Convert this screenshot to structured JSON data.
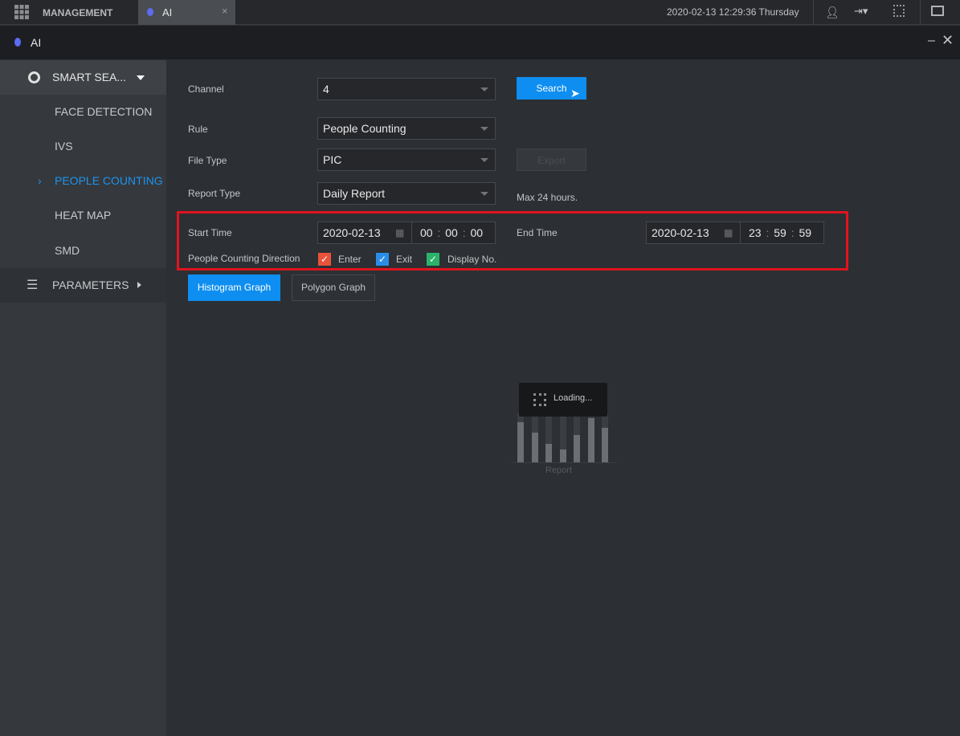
{
  "topbar": {
    "management_label": "MANAGEMENT",
    "tab_label": "AI",
    "datetime": "2020-02-13 12:29:36 Thursday"
  },
  "window": {
    "title": "AI"
  },
  "sidebar": {
    "smart_search": "SMART SEA...",
    "items": [
      {
        "label": "FACE DETECTION"
      },
      {
        "label": "IVS"
      },
      {
        "label": "PEOPLE COUNTING",
        "active": true
      },
      {
        "label": "HEAT MAP"
      },
      {
        "label": "SMD"
      }
    ],
    "parameters": "PARAMETERS"
  },
  "form": {
    "channel_label": "Channel",
    "channel_value": "4",
    "search_label": "Search",
    "rule_label": "Rule",
    "rule_value": "People Counting",
    "file_type_label": "File Type",
    "file_type_value": "PIC",
    "export_label": "Export",
    "report_type_label": "Report Type",
    "report_type_value": "Daily Report",
    "max_hint": "Max 24 hours.",
    "start_time_label": "Start Time",
    "start_date": "2020-02-13",
    "start_h": "00",
    "start_m": "00",
    "start_s": "00",
    "end_time_label": "End Time",
    "end_date": "2020-02-13",
    "end_h": "23",
    "end_m": "59",
    "end_s": "59",
    "direction_label": "People Counting Direction",
    "enter_label": "Enter",
    "exit_label": "Exit",
    "display_label": "Display No.",
    "colors": {
      "enter": "#e8533a",
      "exit": "#2a8ee8",
      "display": "#2bb36b",
      "accent": "#0e8ef0",
      "highlight": "#e0141e"
    }
  },
  "graph_tabs": {
    "histogram": "Histogram Graph",
    "polygon": "Polygon Graph"
  },
  "loading": {
    "text": "Loading...",
    "caption": "Report",
    "bar_levels": [
      0.82,
      0.6,
      0.38,
      0.27,
      0.55,
      0.9,
      0.7
    ]
  }
}
